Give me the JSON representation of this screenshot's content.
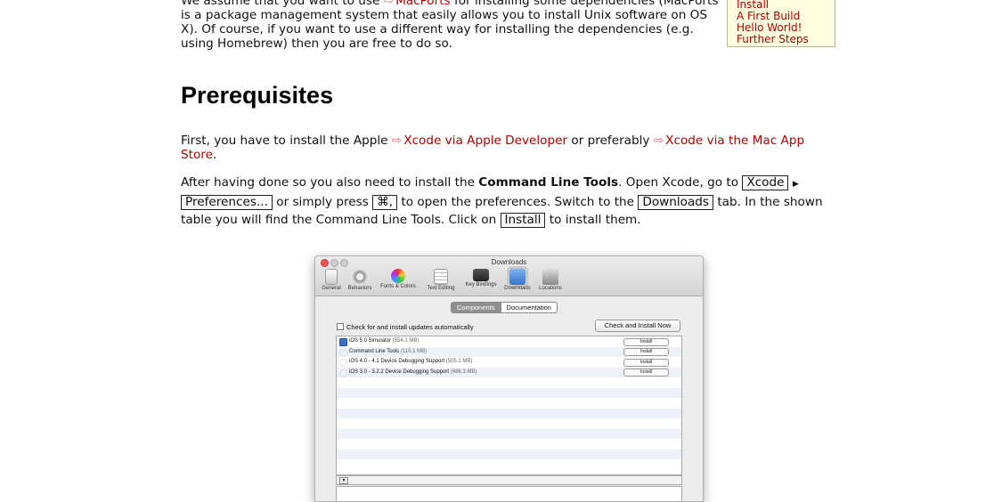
{
  "intro": {
    "line_top": "We assume that you want to use",
    "macports_link": "MacPorts",
    "line_top_rest": "for installing some dependencies (MacPorts",
    "line2": "is a package management system that easily allows you to install Unix software on OS",
    "line3": "X). Of course, if you want to use a different way for installing the dependencies (e.g.",
    "line4": "using Homebrew) then you are free to do so."
  },
  "toc": {
    "items": [
      "Install",
      "A First Build",
      "Hello World!",
      "Further Steps"
    ]
  },
  "heading": "Prerequisites",
  "para1": {
    "prefix": "First, you have to install the Apple",
    "link1": "Xcode via Apple Developer",
    "middle": "or preferably",
    "link2a": "Xcode via the Mac App",
    "link2b": "Store",
    "suffix": "."
  },
  "para2": {
    "t1": "After having done so you also need to install the",
    "bold": "Command Line Tools",
    "t2": ". Open Xcode, go to",
    "kbd_xcode": "Xcode",
    "kbd_prefs": "Preferences...",
    "t3": "or simply press",
    "kbd_shortcut": "⌘,",
    "t4": "to open the preferences. Switch to the",
    "kbd_downloads": "Downloads",
    "t5": "tab. In the shown",
    "t6": "table you will find the Command Line Tools. Click on",
    "kbd_install": "Install",
    "t7": "to install them."
  },
  "window": {
    "title": "Downloads",
    "toolbar": [
      "General",
      "Behaviors",
      "Fonts & Colors",
      "Text Editing",
      "Key Bindings",
      "Downloads",
      "Locations"
    ],
    "tabs": [
      "Components",
      "Documentation"
    ],
    "checkbox_label": "Check for and install updates automatically",
    "check_now": "Check and Install Now",
    "rows": [
      {
        "name": "iOS 5.0 Simulator",
        "size": "(554.1 MB)",
        "button": "Install"
      },
      {
        "name": "Command Line Tools",
        "size": "(115.1 MB)",
        "button": "Install"
      },
      {
        "name": "iOS 4.0 - 4.1 Device Debugging Support",
        "size": "(505.1 MB)",
        "button": "Install"
      },
      {
        "name": "iOS 3.0 - 3.2.2 Device Debugging Support",
        "size": "(686.3 MB)",
        "button": "Install"
      }
    ],
    "toggle_icon": "▼"
  },
  "colors": {
    "link": "#b00000",
    "toc_bg": "#ffffe0"
  }
}
